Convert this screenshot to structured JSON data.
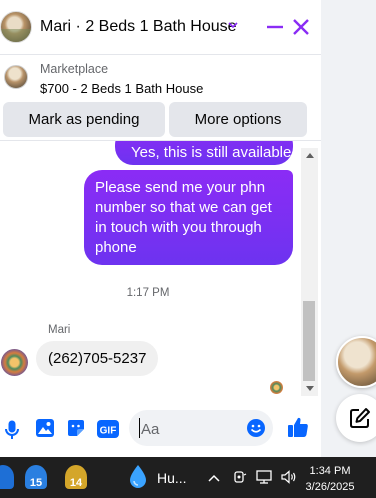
{
  "header": {
    "title": "Mari · 2 Beds 1 Bath House"
  },
  "listing": {
    "subtitle": "Marketplace",
    "price_title": "$700 - 2 Beds 1 Bath House",
    "mark_pending_label": "Mark as pending",
    "more_options_label": "More options"
  },
  "messages": {
    "outgoing": [
      "Yes, this is still available",
      "Please send me your phn number so that we can get in touch with you through phone"
    ],
    "timestamp": "1:17 PM",
    "sender_name": "Mari",
    "incoming": "(262)705-5237"
  },
  "composer": {
    "placeholder": "Aa",
    "gif_label": "GIF"
  },
  "taskbar": {
    "badge_1": "15",
    "badge_2": "14",
    "app_label": "Hu...",
    "time": "1:34 PM",
    "date": "3/26/2025"
  },
  "colors": {
    "accent": "#8a2cf5",
    "composer_icons": "#0866ff",
    "taskbar": "#1f1f1f"
  }
}
